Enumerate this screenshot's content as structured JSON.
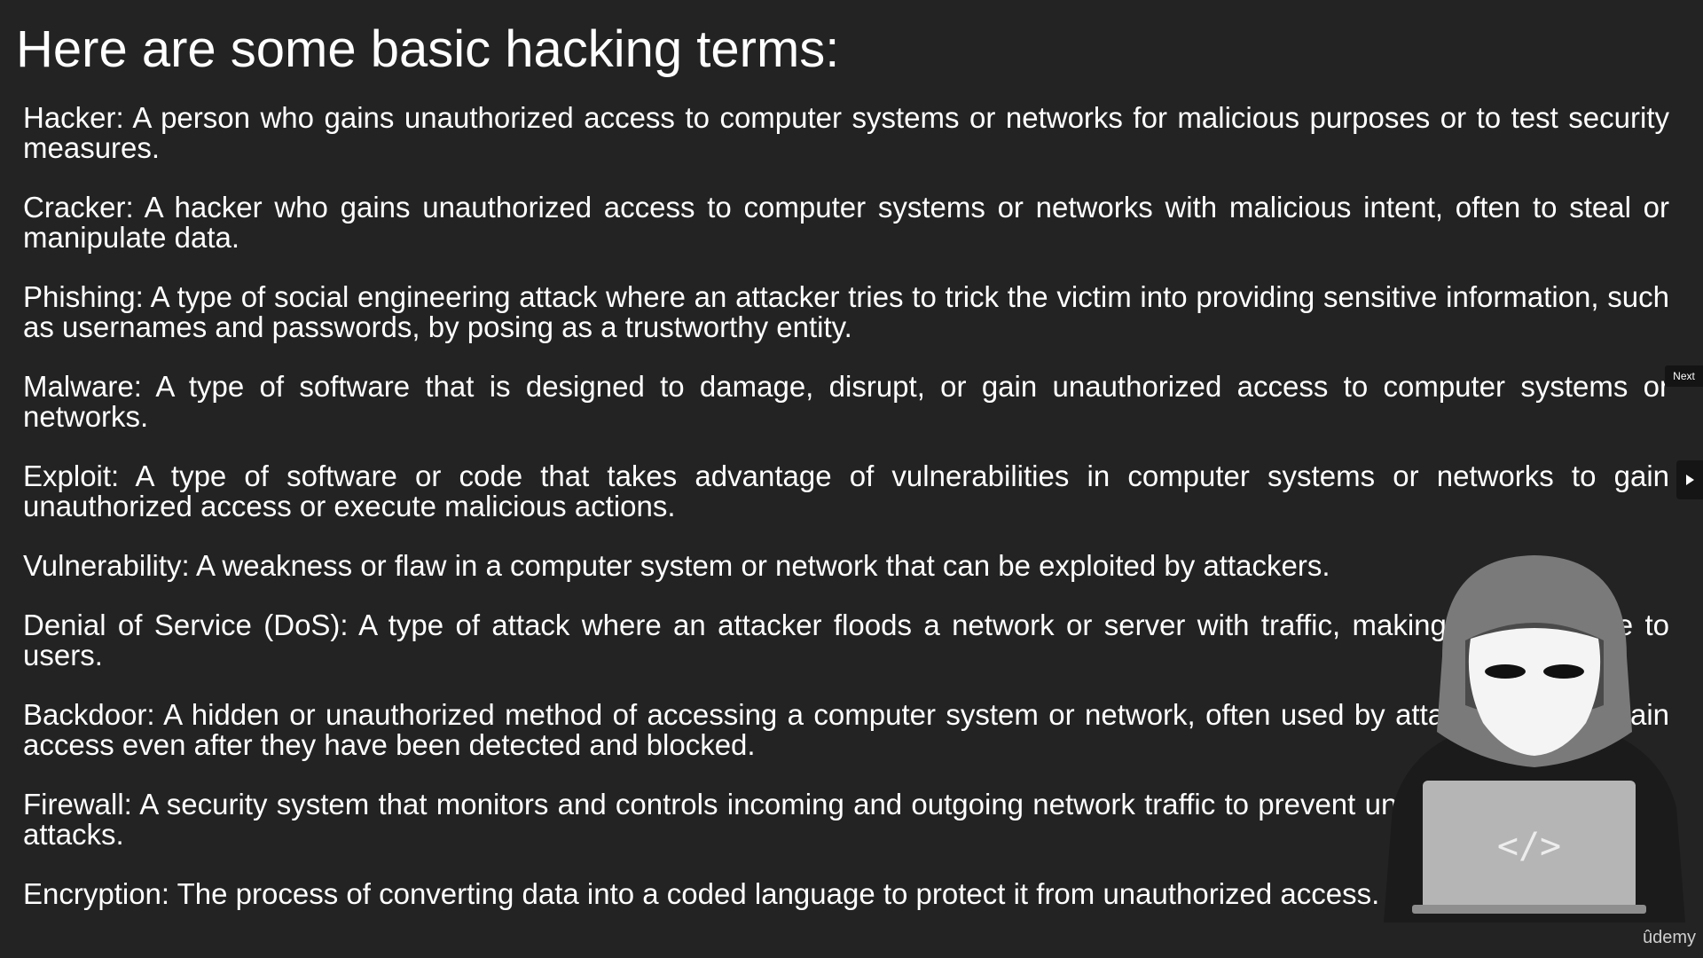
{
  "slide": {
    "title": "Here are some basic hacking terms:",
    "terms": [
      "Hacker: A person who gains unauthorized access to computer systems or networks for malicious purposes or to test security measures.",
      "Cracker: A hacker who gains unauthorized access to computer systems or networks with malicious intent, often to steal or manipulate data.",
      "Phishing: A type of social engineering attack where an attacker tries to trick the victim into providing sensitive information, such as usernames and passwords, by posing as a trustworthy entity.",
      "Malware: A type of software that is designed to damage, disrupt, or gain unauthorized access to computer systems or networks.",
      "Exploit: A type of software or code that takes advantage of vulnerabilities in computer systems or networks to gain unauthorized access or execute malicious actions.",
      "Vulnerability: A weakness or flaw in a computer system or network that can be exploited by attackers.",
      "Denial of Service (DoS): A type of attack where an attacker floods a network or server with traffic, making it unavailable to users.",
      "Backdoor: A hidden or unauthorized method of accessing a computer system or network, often used by attackers to maintain access even after they have been detected and blocked.",
      "Firewall: A security system that monitors and controls incoming and outgoing network traffic to prevent unauthorized access or attacks.",
      "Encryption: The process of converting data into a coded language to protect it from unauthorized access."
    ]
  },
  "illustration": {
    "laptop_code": "</>",
    "icon": "hooded-hacker-icon"
  },
  "player": {
    "next_label": "Next",
    "next_icon": "play-arrow-icon",
    "brand": "ûdemy"
  },
  "colors": {
    "background": "#232323",
    "text": "#ffffff",
    "hood": "#7a7a7a",
    "mask": "#f4f4f4",
    "laptop": "#b5b5b5"
  }
}
